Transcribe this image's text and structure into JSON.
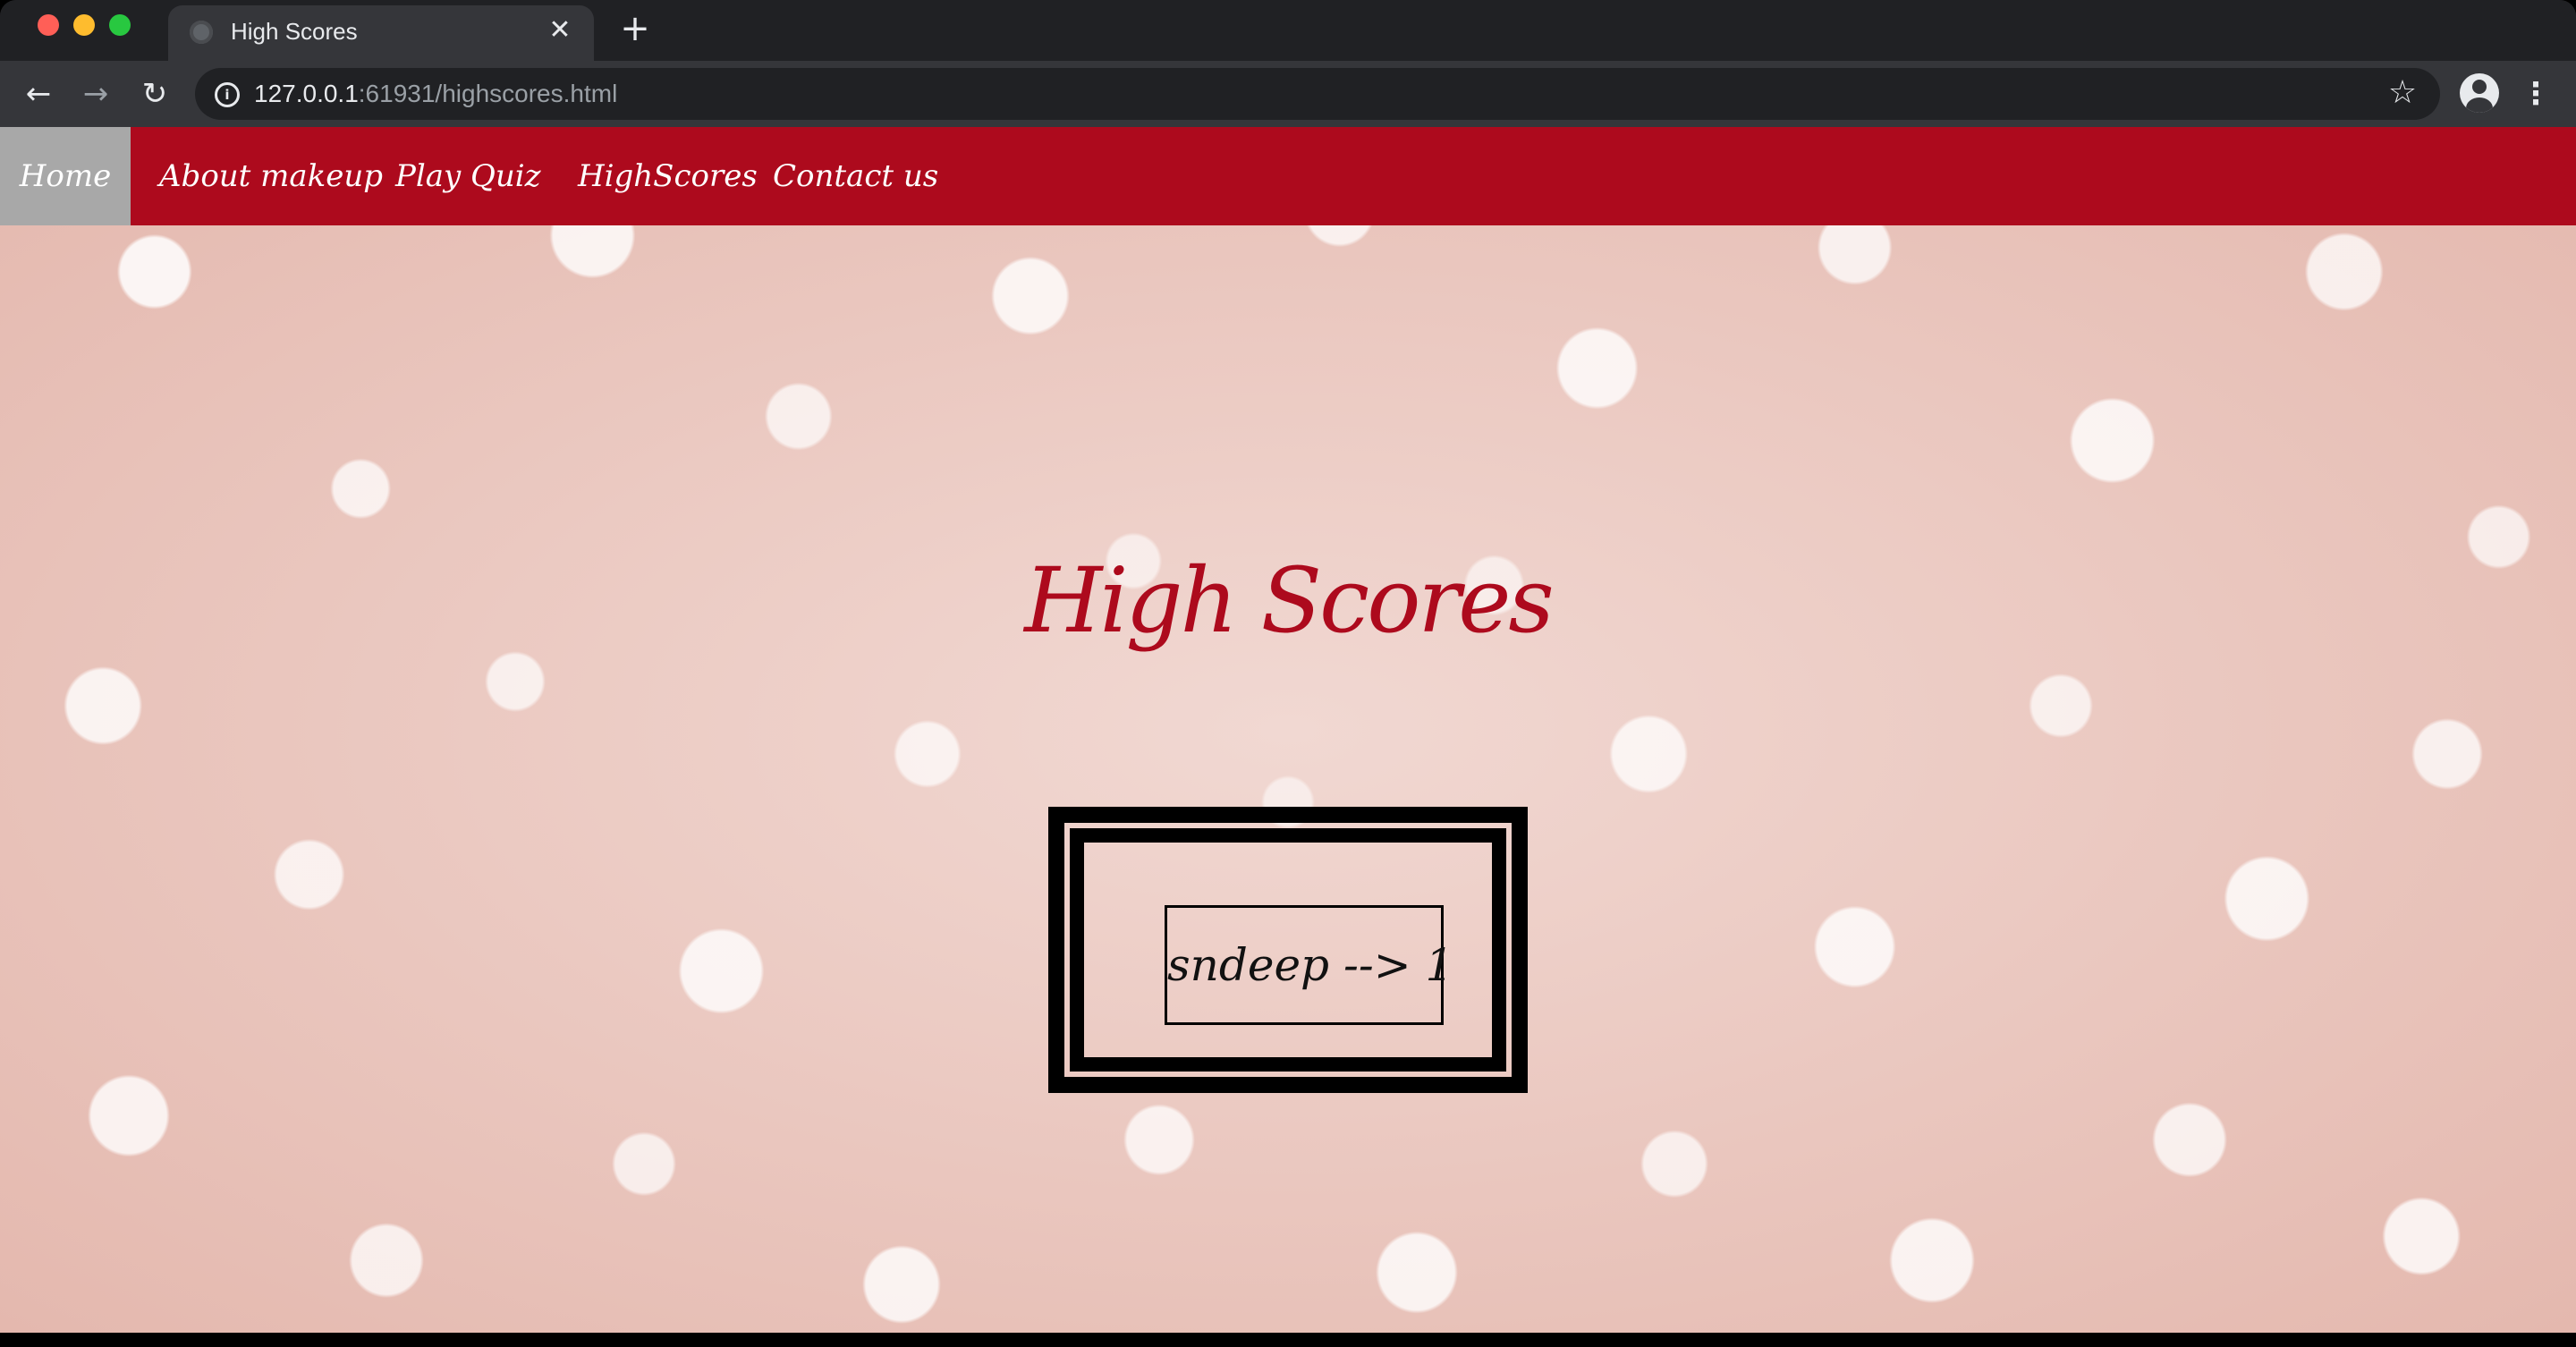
{
  "browser": {
    "tab": {
      "title": "High Scores",
      "close_glyph": "✕",
      "favicon": "globe-icon"
    },
    "new_tab_glyph": "+",
    "back_glyph": "←",
    "forward_glyph": "→",
    "reload_glyph": "↻",
    "url_host": "127.0.0.1",
    "url_rest": ":61931/highscores.html",
    "info_glyph": "i",
    "star_glyph": "☆",
    "menu_glyph": "⋮"
  },
  "site_nav": {
    "items": [
      {
        "label": "Home",
        "active": true
      },
      {
        "label": "About makeup",
        "active": false
      },
      {
        "label": "Play Quiz",
        "active": false
      },
      {
        "label": "HighScores",
        "active": false
      },
      {
        "label": "Contact us",
        "active": false
      }
    ],
    "bar_color": "#ad0a1d",
    "active_color": "#a8a8a8"
  },
  "main": {
    "title": "High Scores",
    "scores": [
      {
        "text": "sndeep --> 1"
      }
    ]
  }
}
